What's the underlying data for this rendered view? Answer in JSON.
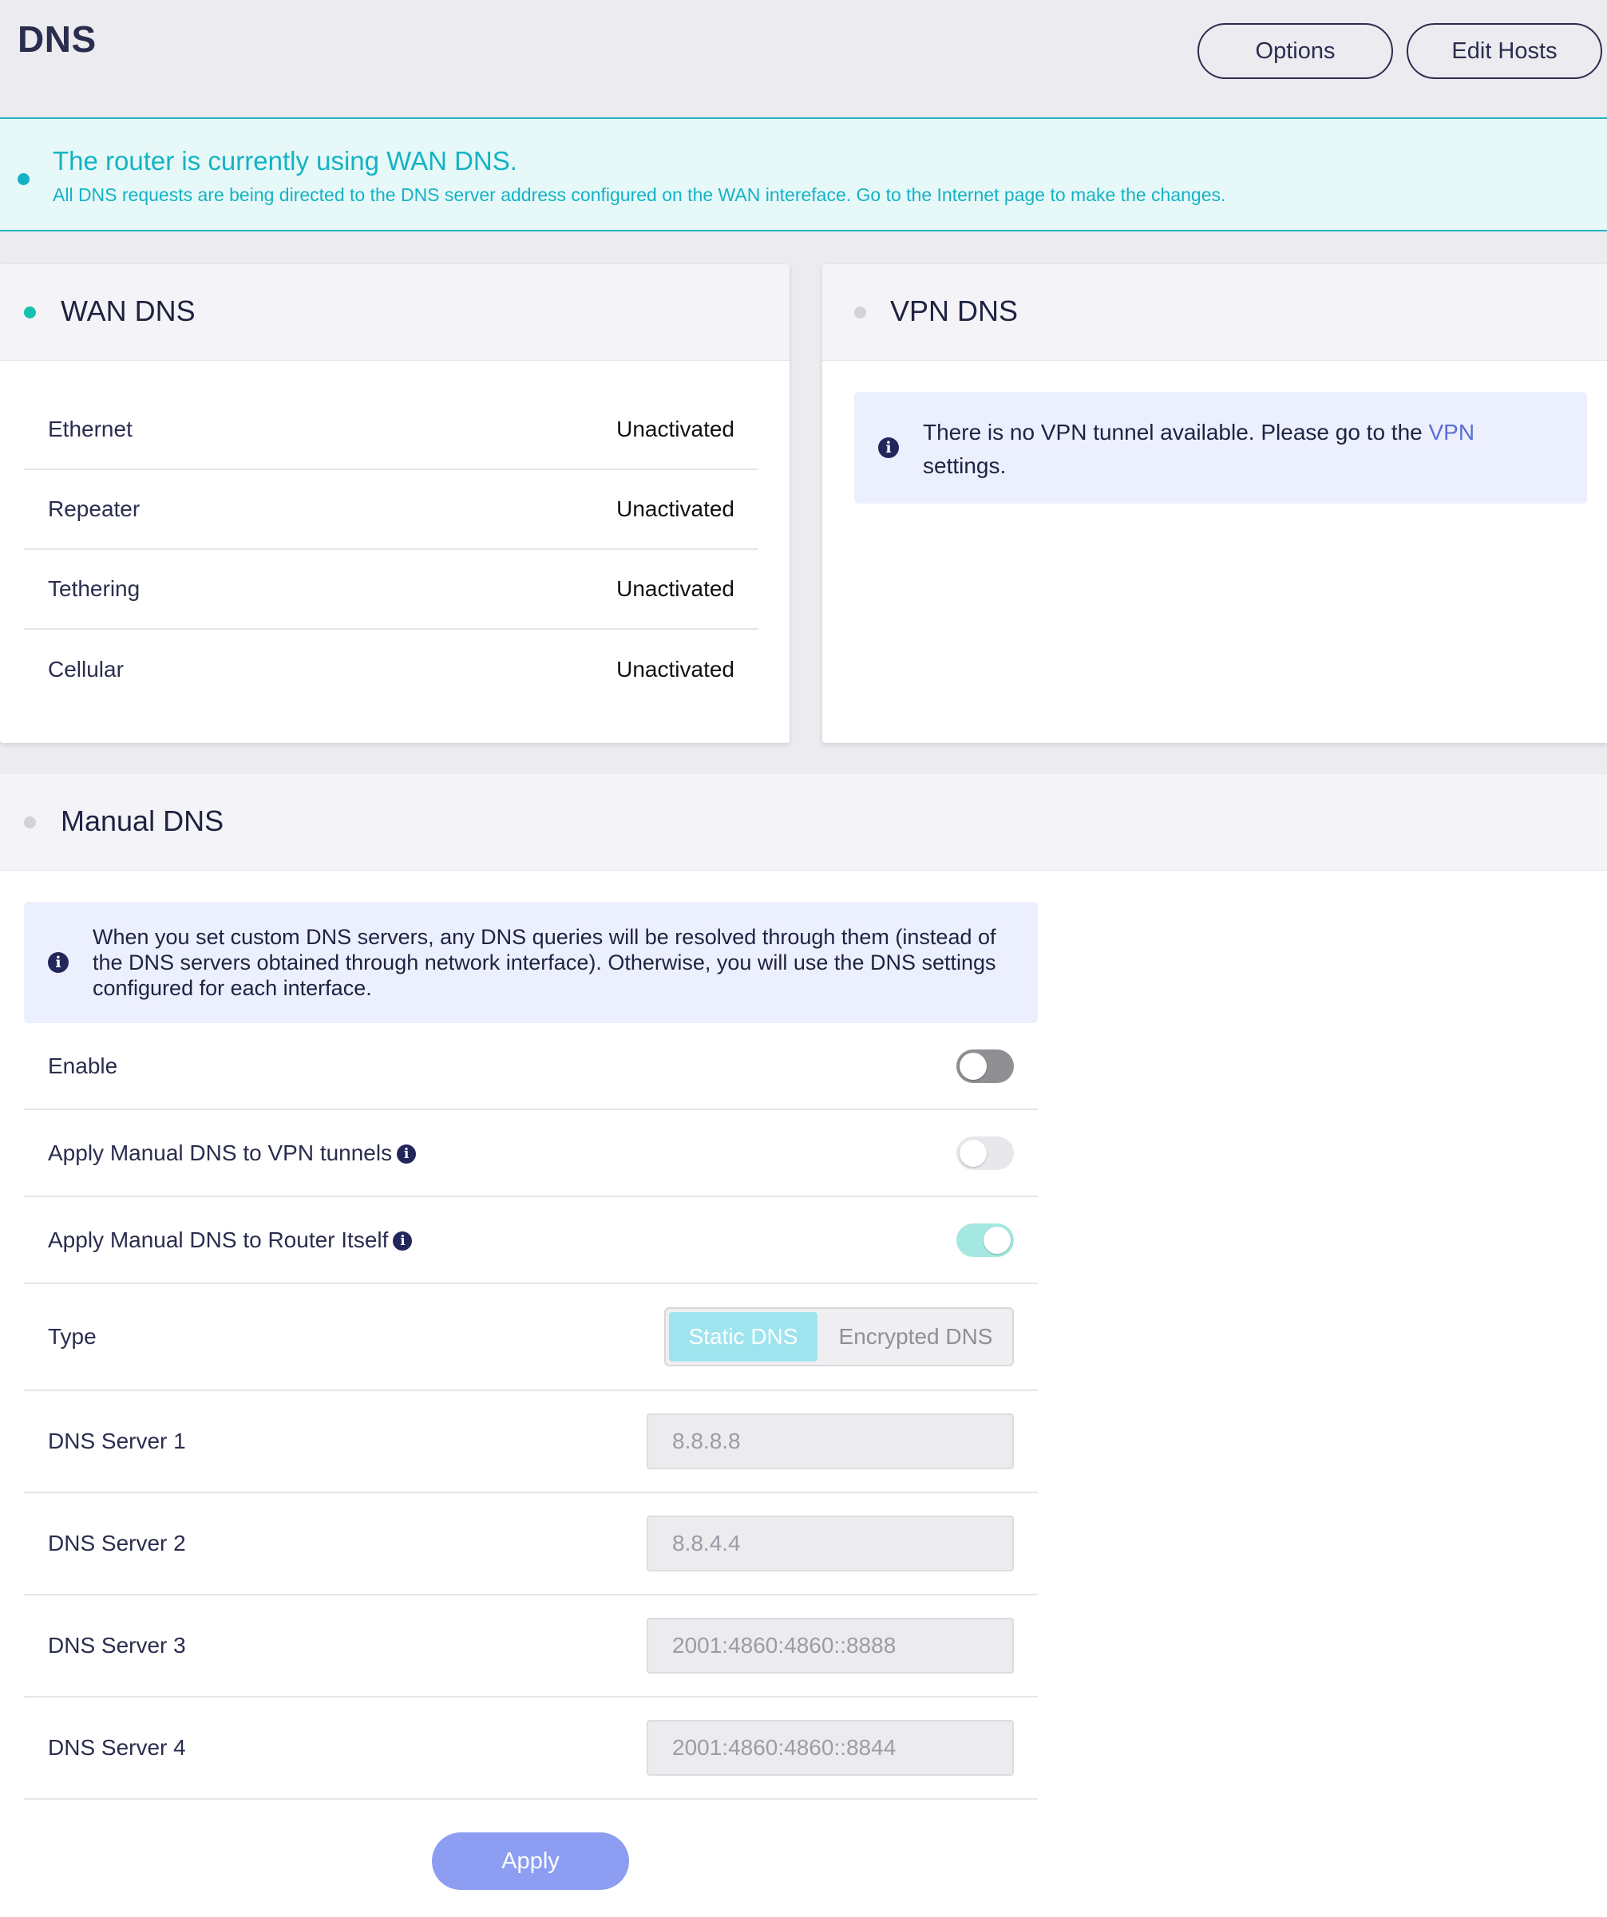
{
  "header": {
    "title": "DNS",
    "options_label": "Options",
    "edit_hosts_label": "Edit Hosts"
  },
  "banner": {
    "title": "The router is currently using WAN DNS.",
    "description": "All DNS requests are being directed to the DNS server address configured on the WAN intereface. Go to the Internet page to make the changes."
  },
  "wan_dns": {
    "title": "WAN DNS",
    "rows": [
      {
        "label": "Ethernet",
        "value": "Unactivated"
      },
      {
        "label": "Repeater",
        "value": "Unactivated"
      },
      {
        "label": "Tethering",
        "value": "Unactivated"
      },
      {
        "label": "Cellular",
        "value": "Unactivated"
      }
    ]
  },
  "vpn_dns": {
    "title": "VPN DNS",
    "info_text_before": "There is no VPN tunnel available. Please go to the ",
    "info_link": "VPN",
    "info_text_after": "settings."
  },
  "manual_dns": {
    "title": "Manual DNS",
    "info_text": "When you set custom DNS servers, any DNS queries will be resolved through them (instead of the DNS servers obtained through network interface). Otherwise, you will use the DNS settings configured for each interface.",
    "enable_label": "Enable",
    "enable_on": false,
    "vpn_tunnels_label": "Apply Manual DNS to VPN tunnels",
    "vpn_tunnels_on": false,
    "router_itself_label": "Apply Manual DNS to Router Itself",
    "router_itself_on": true,
    "type_label": "Type",
    "type_options": [
      "Static DNS",
      "Encrypted DNS"
    ],
    "type_selected": "Static DNS",
    "servers": [
      {
        "label": "DNS Server 1",
        "placeholder": "8.8.8.8"
      },
      {
        "label": "DNS Server 2",
        "placeholder": "8.8.4.4"
      },
      {
        "label": "DNS Server 3",
        "placeholder": "2001:4860:4860::8888"
      },
      {
        "label": "DNS Server 4",
        "placeholder": "2001:4860:4860::8844"
      }
    ],
    "apply_label": "Apply"
  },
  "colors": {
    "accent_teal": "#13b3c4",
    "navy": "#2a2d4e",
    "apply_blue": "#8c9df2",
    "toggle_on": "#a5e8e1"
  },
  "icons": [
    "status-dot",
    "info-icon"
  ]
}
